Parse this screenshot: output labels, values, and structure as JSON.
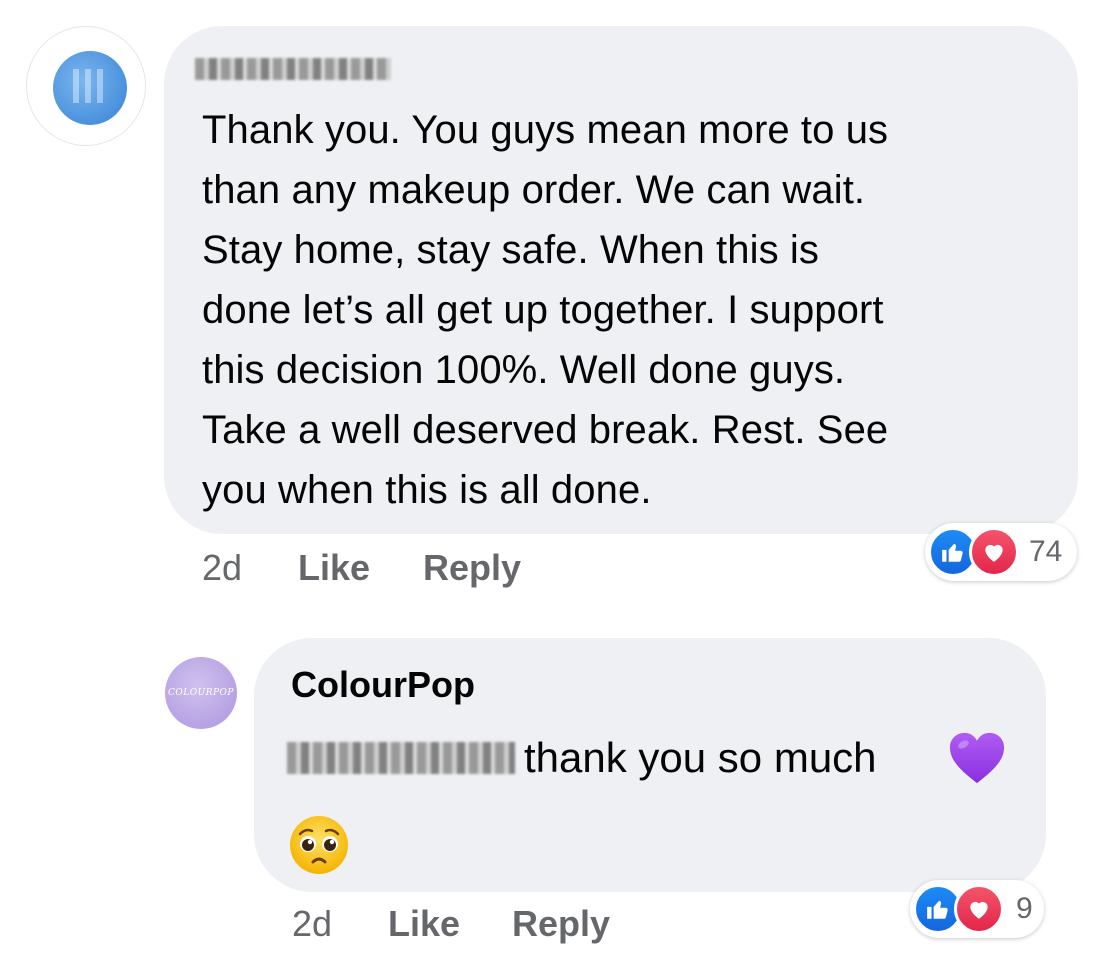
{
  "comment": {
    "text": "Thank you. You guys mean more to us\nthan any makeup order. We can wait.\nStay home, stay safe. When this is\ndone let’s all get up together. I support\nthis decision 100%. Well done guys.\nTake a well deserved break. Rest. See\nyou when this is all done.",
    "time": "2d",
    "like_label": "Like",
    "reply_label": "Reply",
    "reaction_count": "74"
  },
  "reply": {
    "author": "ColourPop",
    "avatar_text": "COLOURPOP",
    "text": "thank you so much",
    "time": "2d",
    "like_label": "Like",
    "reply_label": "Reply",
    "reaction_count": "9"
  },
  "icons": [
    "like-reaction-icon",
    "love-reaction-icon",
    "purple-heart-emoji",
    "pleading-face-emoji"
  ],
  "colors": {
    "bubble": "#eff0f4",
    "meta_text": "#65676b",
    "like_blue": "#1877f2",
    "love_red": "#f33e58",
    "purple_heart": "#9b40e6"
  }
}
